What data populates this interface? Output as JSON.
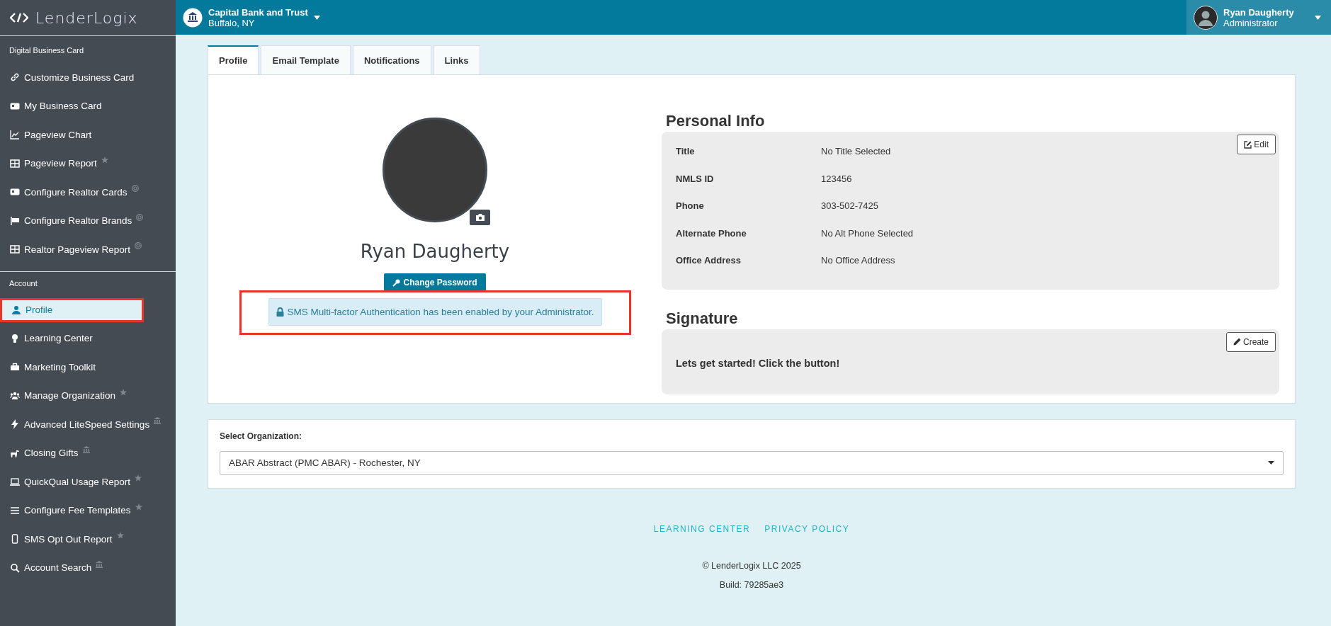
{
  "brand": {
    "name": "LenderLogix"
  },
  "sidebar": {
    "sections": [
      {
        "title": "Digital Business Card",
        "items": [
          {
            "label": "Customize Business Card",
            "selected": false,
            "highlighted": false
          },
          {
            "label": "My Business Card",
            "selected": false,
            "highlighted": false
          },
          {
            "label": "Pageview Chart",
            "selected": false,
            "highlighted": false
          },
          {
            "label": "Pageview Report",
            "selected": false,
            "highlighted": false
          },
          {
            "label": "Configure Realtor Cards",
            "selected": false,
            "highlighted": false
          },
          {
            "label": "Configure Realtor Brands",
            "selected": false,
            "highlighted": false
          },
          {
            "label": "Realtor Pageview Report",
            "selected": false,
            "highlighted": false
          }
        ]
      },
      {
        "title": "Account",
        "items": [
          {
            "label": "Profile",
            "selected": true,
            "highlighted": true
          },
          {
            "label": "Learning Center",
            "selected": false,
            "highlighted": false
          },
          {
            "label": "Marketing Toolkit",
            "selected": false,
            "highlighted": false
          },
          {
            "label": "Manage Organization",
            "selected": false,
            "highlighted": false
          },
          {
            "label": "Advanced LiteSpeed Settings",
            "selected": false,
            "highlighted": false
          },
          {
            "label": "Closing Gifts",
            "selected": false,
            "highlighted": false
          },
          {
            "label": "QuickQual Usage Report",
            "selected": false,
            "highlighted": false
          },
          {
            "label": "Configure Fee Templates",
            "selected": false,
            "highlighted": false
          },
          {
            "label": "SMS Opt Out Report",
            "selected": false,
            "highlighted": false
          },
          {
            "label": "Account Search",
            "selected": false,
            "highlighted": false
          }
        ]
      }
    ]
  },
  "header": {
    "company": "Capital Bank and Trust",
    "location": "Buffalo, NY",
    "user_name": "Ryan Daugherty",
    "user_role": "Administrator"
  },
  "tabs": [
    {
      "label": "Profile",
      "selected": true
    },
    {
      "label": "Email Template",
      "selected": false
    },
    {
      "label": "Notifications",
      "selected": false
    },
    {
      "label": "Links",
      "selected": false
    }
  ],
  "profile": {
    "name": "Ryan Daugherty",
    "change_password": "Change Password",
    "alert": "SMS Multi-factor Authentication has been enabled by your Administrator.",
    "alert_highlighted": true
  },
  "personal_info": {
    "title": "Personal Info",
    "edit": "Edit",
    "rows": [
      {
        "label": "Title",
        "value": "No Title Selected"
      },
      {
        "label": "NMLS ID",
        "value": "123456"
      },
      {
        "label": "Phone",
        "value": "303-502-7425"
      },
      {
        "label": "Alternate Phone",
        "value": "No Alt Phone Selected"
      },
      {
        "label": "Office Address",
        "value": "No Office Address"
      }
    ]
  },
  "signature": {
    "title": "Signature",
    "create": "Create",
    "message": "Lets get started! Click the button!"
  },
  "organization": {
    "label": "Select Organization:",
    "value": "ABAR Abstract (PMC ABAR) - Rochester, NY"
  },
  "footer": {
    "links": [
      "LEARNING CENTER",
      "PRIVACY POLICY"
    ],
    "copyright": "© LenderLogix LLC 2025",
    "build": "Build: 79285ae3"
  }
}
